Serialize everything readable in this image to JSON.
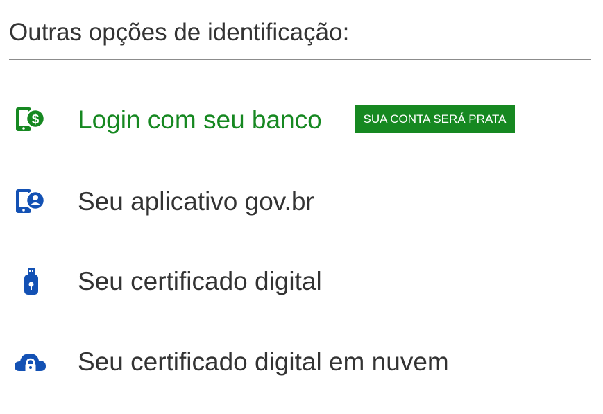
{
  "heading": "Outras opções de identificação:",
  "options": [
    {
      "label": "Login com seu banco",
      "icon": "bank-phone-icon",
      "badge": "SUA CONTA SERÁ PRATA",
      "color": "#168821"
    },
    {
      "label": "Seu aplicativo gov.br",
      "icon": "govbr-app-icon",
      "color": "#1351b4"
    },
    {
      "label": "Seu certificado digital",
      "icon": "usb-token-icon",
      "color": "#1351b4"
    },
    {
      "label": "Seu certificado digital em nuvem",
      "icon": "cloud-lock-icon",
      "color": "#1351b4"
    }
  ],
  "colors": {
    "green": "#168821",
    "blue": "#1351b4",
    "text": "#333333",
    "divider": "#8c8c8c"
  }
}
